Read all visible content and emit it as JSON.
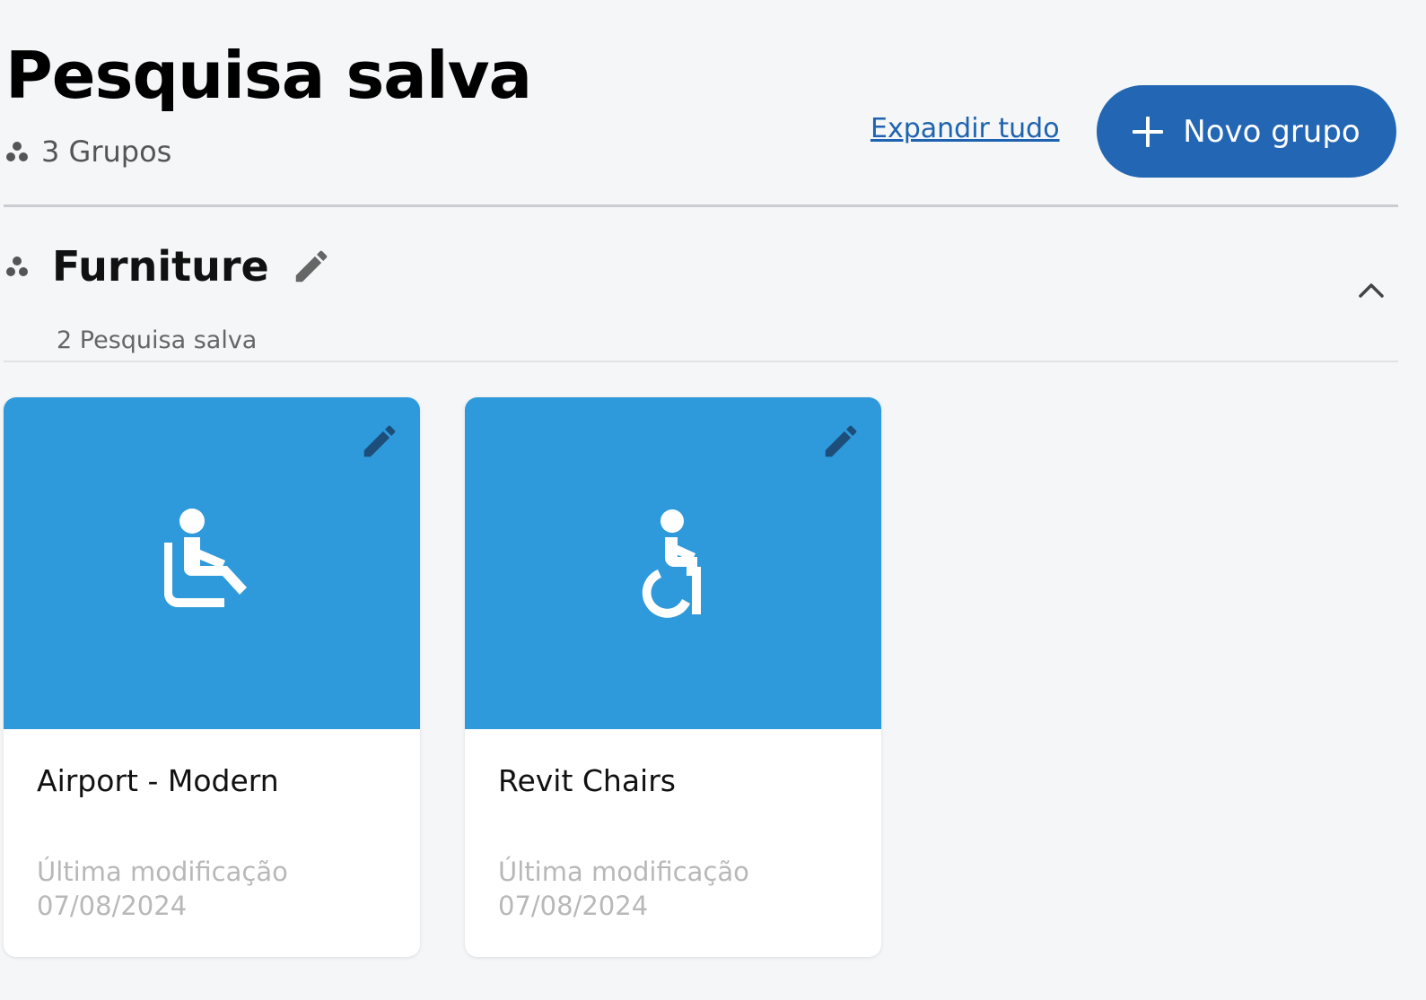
{
  "header": {
    "title": "Pesquisa salva",
    "groups_count": "3 Grupos",
    "expand_all": "Expandir tudo",
    "new_group": "Novo grupo"
  },
  "group": {
    "name": "Furniture",
    "count": "2 Pesquisa salva",
    "expanded": true
  },
  "cards": [
    {
      "title": "Airport - Modern",
      "modified_label": "Última modificação",
      "modified_date": "07/08/2024",
      "icon": "seated-person-icon"
    },
    {
      "title": "Revit Chairs",
      "modified_label": "Última modificação",
      "modified_date": "07/08/2024",
      "icon": "wheelchair-icon"
    }
  ],
  "colors": {
    "primary": "#2366b4",
    "card_banner": "#2e9adb",
    "link": "#1f63b0",
    "background": "#f4f6f8"
  }
}
